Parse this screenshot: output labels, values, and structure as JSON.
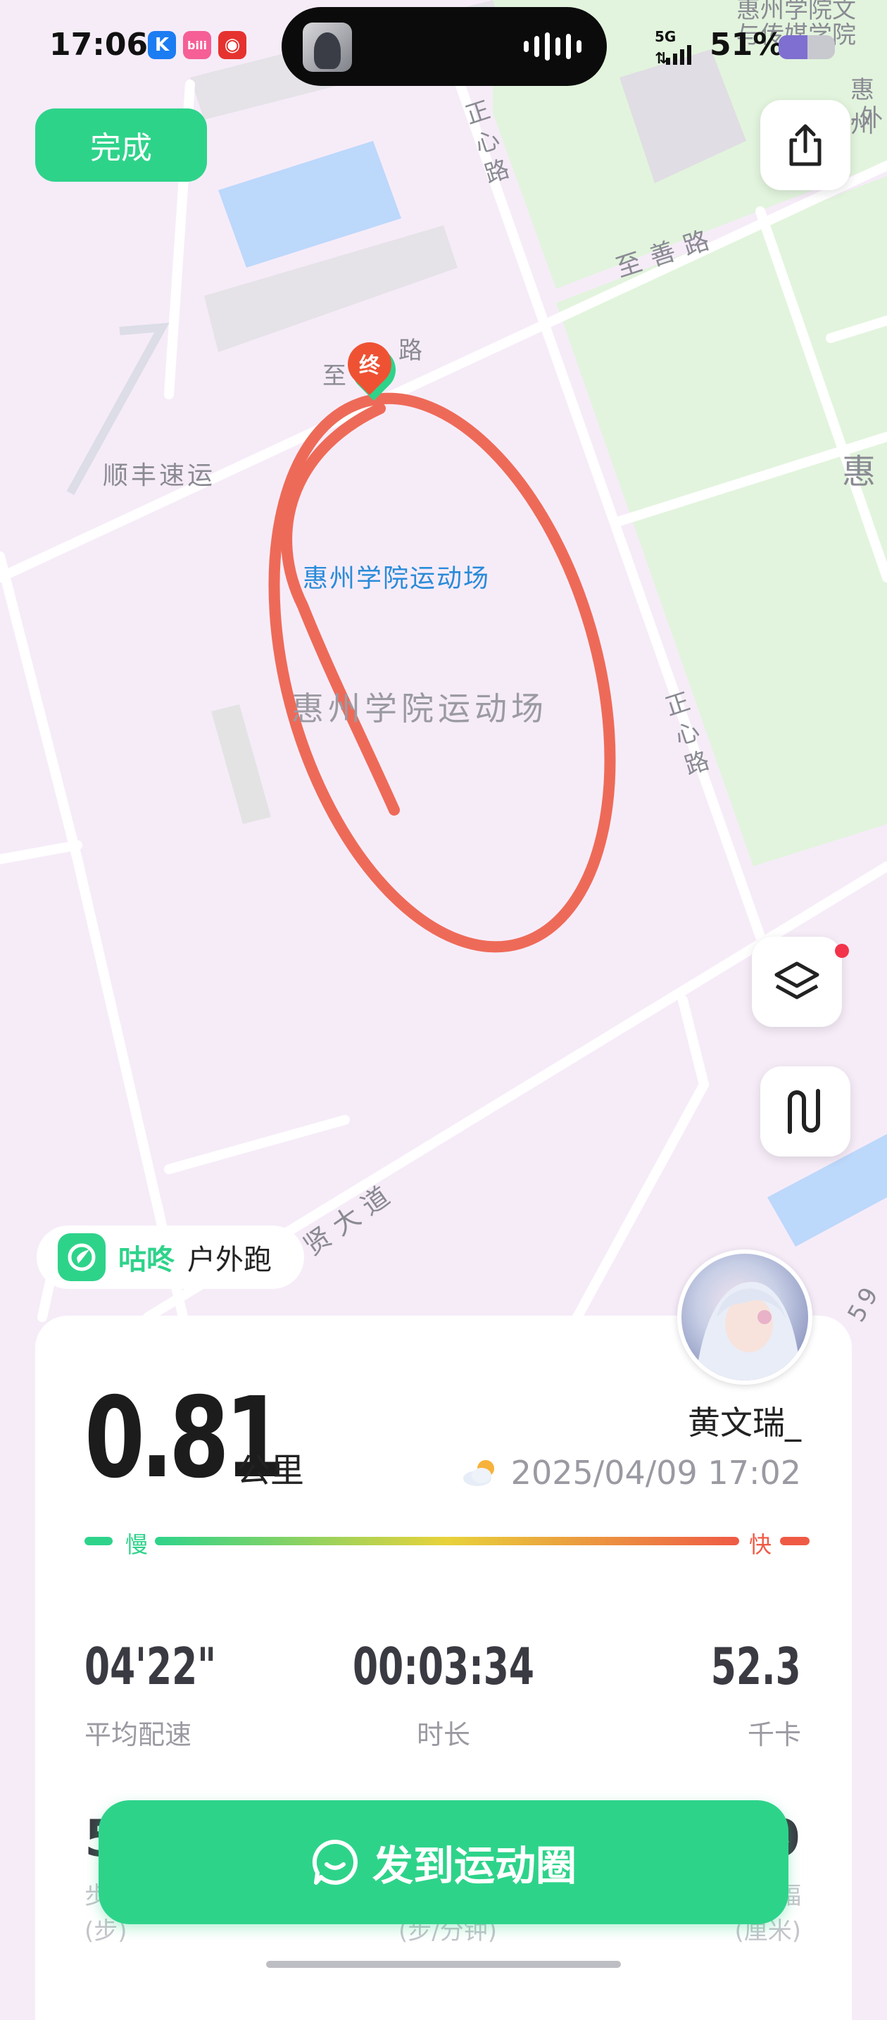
{
  "status_bar": {
    "time": "17:06",
    "signal": "5G",
    "battery": "51%",
    "battery_level": 0.51,
    "app_icons": [
      "kugou-icon",
      "bilibili-icon",
      "netease-music-icon"
    ]
  },
  "toolbar": {
    "done_label": "完成",
    "icons": {
      "share": "share-icon",
      "layers": "layers-icon",
      "track": "track-icon"
    }
  },
  "map": {
    "labels": {
      "road_zhengxin_top": "正心路",
      "road_zhishan": "至善路",
      "road_zhi": "至",
      "road_lu": "路",
      "poi_shunfeng": "顺丰速运",
      "venue_blue": "惠州学院运动场",
      "venue_gray": "惠州学院运动场",
      "road_zhengxin_mid": "正心路",
      "road_xian": "贤大道",
      "top_right_1": "惠州学院文",
      "top_right_2": "与传媒学院",
      "right_hui": "惠",
      "right_wai": "惠州",
      "right_wai2": "-外",
      "right_59": "59"
    },
    "end_marker": "终"
  },
  "brand": {
    "name": "咕咚",
    "sport": "户外跑"
  },
  "summary": {
    "distance": "0.81",
    "distance_unit": "公里",
    "username": "黄文瑞_",
    "datetime": "2025/04/09 17:02",
    "weather_icon": "partly-cloudy-icon",
    "pace_slow": "慢",
    "pace_fast": "快",
    "stats": [
      {
        "value": "04'22\"",
        "label": "平均配速"
      },
      {
        "value": "00:03:34",
        "label": "时长"
      },
      {
        "value": "52.3",
        "label": "千卡"
      }
    ],
    "peek_left_value": "5",
    "peek_right_value": "9",
    "peek_labels": {
      "left_a": "步",
      "left_b": "(步)",
      "mid": "(步/分钟)",
      "right_a": "幅",
      "right_b": "(厘米)"
    }
  },
  "share_button": {
    "label": "发到运动圈"
  }
}
